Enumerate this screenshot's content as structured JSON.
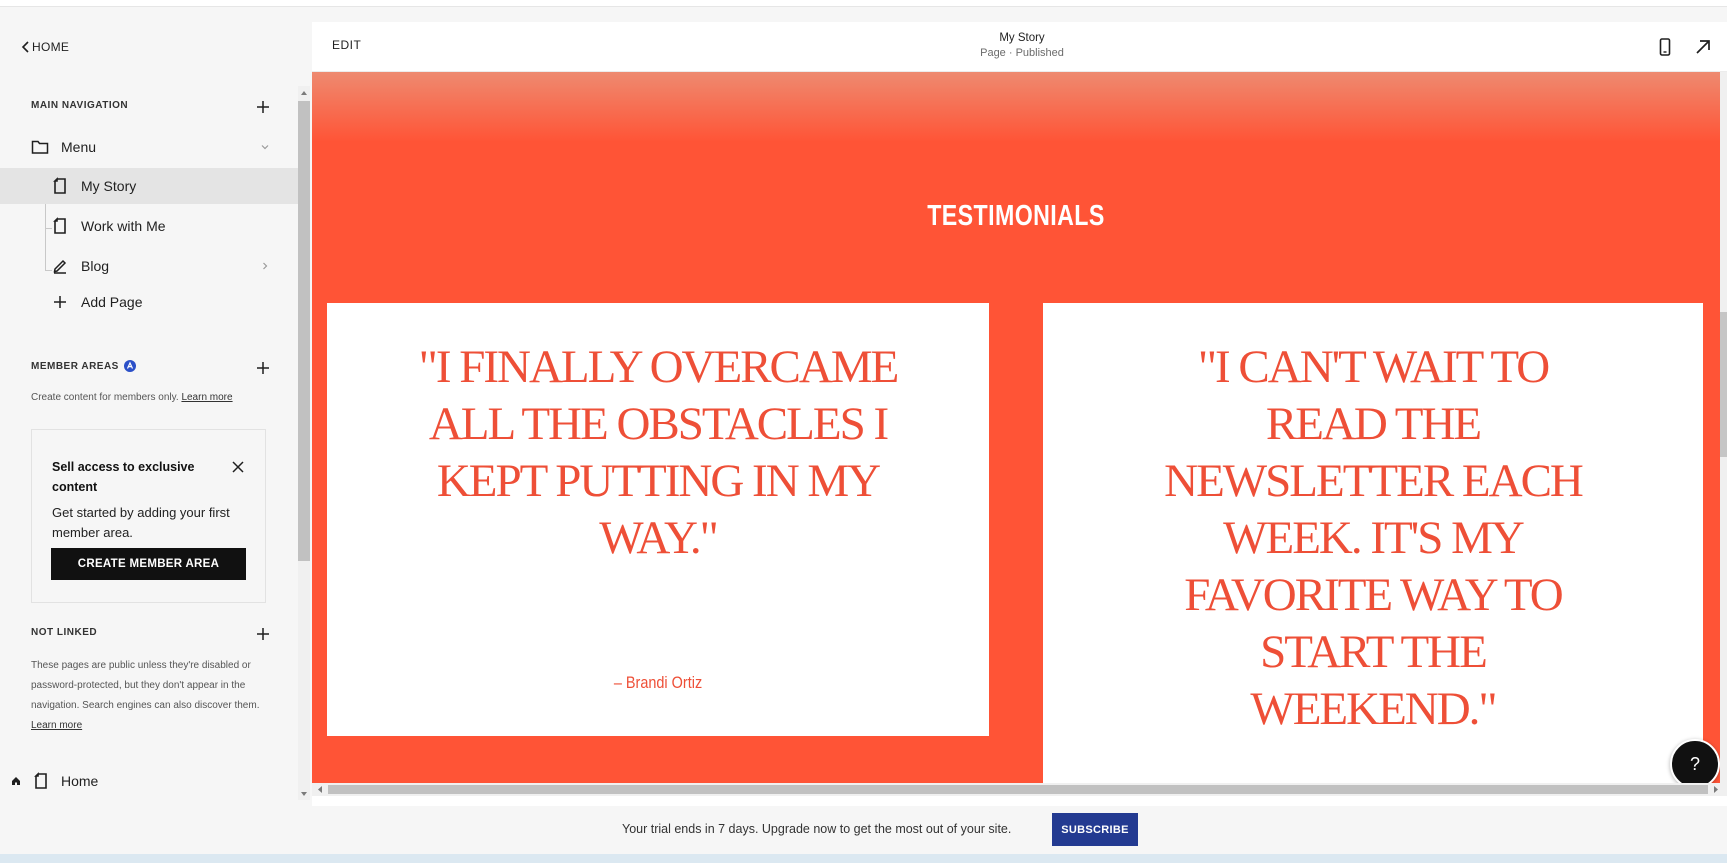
{
  "sidebar": {
    "home_label": "HOME",
    "main_navigation": {
      "heading": "MAIN NAVIGATION",
      "folder_label": "Menu",
      "items": [
        {
          "label": "My Story",
          "selected": true
        },
        {
          "label": "Work with Me"
        },
        {
          "label": "Blog"
        }
      ],
      "add_page_label": "Add Page"
    },
    "member_areas": {
      "heading": "MEMBER AREAS",
      "description": "Create content for members only.",
      "learn_more": "Learn more",
      "promo": {
        "title": "Sell access to exclusive content",
        "text": "Get started by adding your first member area.",
        "button_label": "CREATE MEMBER AREA"
      }
    },
    "not_linked": {
      "heading": "NOT LINKED",
      "description": "These pages are public unless they're disabled or password-protected, but they don't appear in the navigation. Search engines can also discover them.",
      "learn_more": "Learn more",
      "items": [
        {
          "label": "Home"
        }
      ]
    }
  },
  "header": {
    "edit_label": "EDIT",
    "page_title": "My Story",
    "page_status": "Page · Published",
    "icons": [
      "mobile-preview-icon",
      "open-external-icon"
    ]
  },
  "canvas": {
    "section_heading": "TESTIMONIALS",
    "testimonials": [
      {
        "quote": "\"I FINALLY OVERCAME ALL THE OBSTACLES I KEPT PUTTING IN MY WAY.\"",
        "author": "– Brandi Ortiz"
      },
      {
        "quote": "\"I CAN'T WAIT TO READ THE NEWSLETTER EACH WEEK. IT'S MY FAVORITE WAY TO START THE WEEKEND.\""
      }
    ],
    "help_label": "?"
  },
  "trial_bar": {
    "text": "Your trial ends in 7 days. Upgrade now to get the most out of your site.",
    "button_label": "SUBSCRIBE"
  },
  "colors": {
    "accent_orange": "#ff5436",
    "quote_text": "#ee4f37",
    "subscribe_blue": "#233a91",
    "member_badge_blue": "#2b50c8"
  }
}
